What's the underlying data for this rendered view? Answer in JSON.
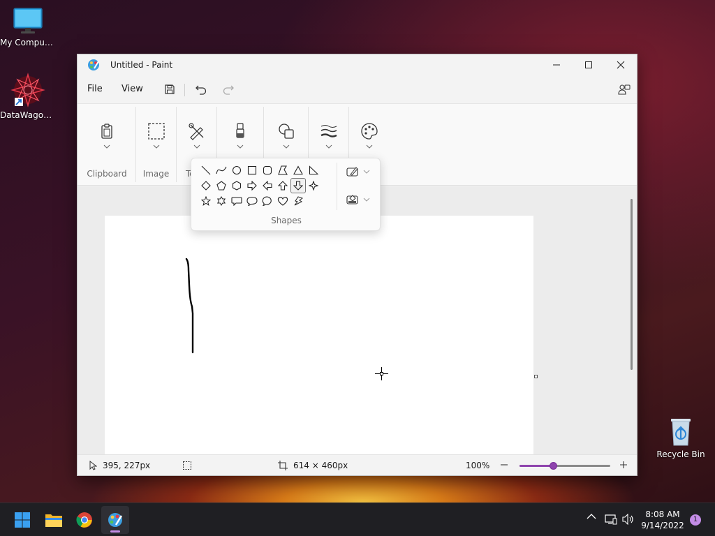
{
  "desktop": {
    "icons": [
      {
        "label": "My Computer"
      },
      {
        "label": "DataWagon..."
      },
      {
        "label": "Recycle Bin"
      }
    ]
  },
  "window": {
    "title": "Untitled - Paint",
    "menu": {
      "file": "File",
      "view": "View"
    },
    "ribbon": {
      "clipboard": "Clipboard",
      "image": "Image",
      "tools_partial": "To"
    },
    "shapes_flyout": {
      "label": "Shapes",
      "selected": "arrow-down-shape"
    },
    "status": {
      "cursor_pos": "395, 227px",
      "canvas_size": "614 × 460px",
      "zoom": "100%",
      "zoom_fraction": 0.38
    }
  },
  "taskbar": {
    "time": "8:08 AM",
    "date": "9/14/2022",
    "notification_count": "1"
  },
  "colors": {
    "accent": "#8e44ad",
    "taskbar": "#1f1f23"
  }
}
